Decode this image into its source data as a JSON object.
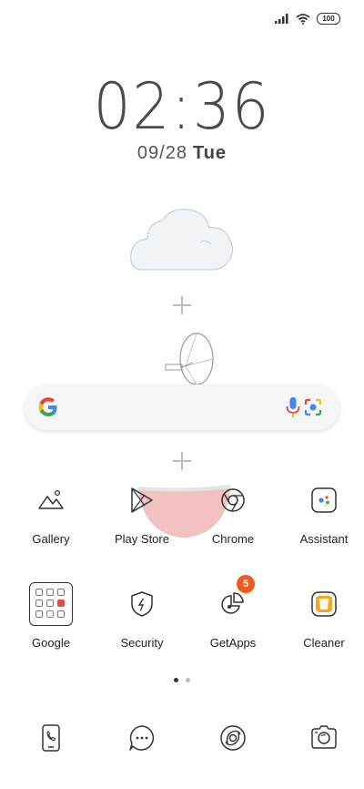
{
  "status_bar": {
    "battery": "100"
  },
  "clock": {
    "time": "02:36",
    "date": "09/28",
    "day": "Tue"
  },
  "apps": [
    {
      "label": "Gallery",
      "icon": "gallery-icon"
    },
    {
      "label": "Play Store",
      "icon": "play-store-icon"
    },
    {
      "label": "Chrome",
      "icon": "chrome-icon"
    },
    {
      "label": "Assistant",
      "icon": "assistant-icon"
    },
    {
      "label": "Google",
      "icon": "folder-icon"
    },
    {
      "label": "Security",
      "icon": "shield-icon"
    },
    {
      "label": "GetApps",
      "icon": "getapps-icon",
      "badge": "5"
    },
    {
      "label": "Cleaner",
      "icon": "trash-icon"
    }
  ],
  "dock": [
    "phone-icon",
    "messages-icon",
    "browser-icon",
    "camera-icon"
  ],
  "colors": {
    "badge": "#f05a1c",
    "google_blue": "#4285F4",
    "google_red": "#EA4335",
    "google_yellow": "#FBBC05",
    "google_green": "#34A853",
    "cleaner": "#f5a623"
  }
}
